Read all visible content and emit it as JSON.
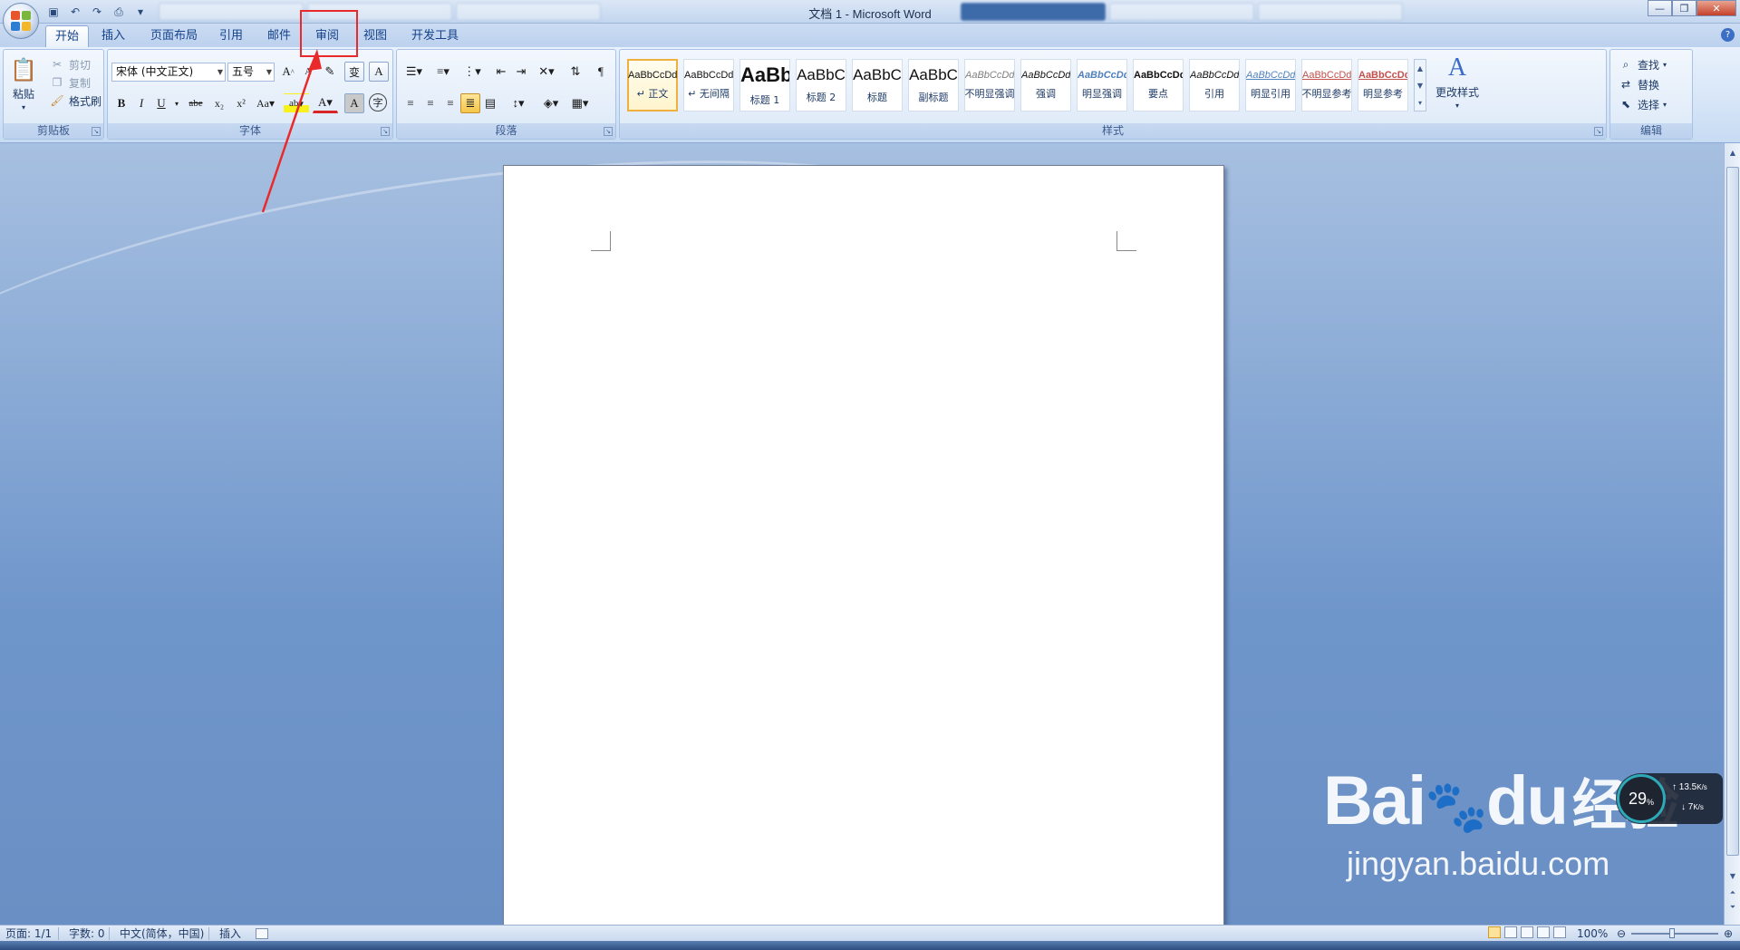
{
  "window": {
    "title": "文档 1 - Microsoft Word",
    "controls": [
      "minimize",
      "restore",
      "close"
    ]
  },
  "tabs": [
    {
      "label": "开始",
      "active": true
    },
    {
      "label": "插入"
    },
    {
      "label": "页面布局"
    },
    {
      "label": "引用"
    },
    {
      "label": "邮件"
    },
    {
      "label": "审阅",
      "highlighted": true
    },
    {
      "label": "视图"
    },
    {
      "label": "开发工具"
    }
  ],
  "clipboard": {
    "paste": "粘贴",
    "cut": "剪切",
    "copy": "复制",
    "format_painter": "格式刷",
    "group": "剪贴板"
  },
  "font": {
    "name": "宋体 (中文正文)",
    "size": "五号",
    "group": "字体",
    "buttons": {
      "grow": "A",
      "shrink": "A",
      "phonetic": "变",
      "border": "A",
      "bold": "B",
      "italic": "I",
      "underline": "U",
      "strike": "abe",
      "subscript": "x₂",
      "superscript": "x²",
      "case": "Aa",
      "highlight": "ab",
      "color": "A",
      "shading": "A",
      "enclose": "字"
    }
  },
  "paragraph": {
    "group": "段落"
  },
  "styles": {
    "group": "样式",
    "items": [
      {
        "sample": "AaBbCcDd",
        "name": "↵ 正文",
        "selected": true
      },
      {
        "sample": "AaBbCcDd",
        "name": "↵ 无间隔"
      },
      {
        "sample": "AaBb",
        "name": "标题 1"
      },
      {
        "sample": "AaBbC",
        "name": "标题 2"
      },
      {
        "sample": "AaBbC",
        "name": "标题"
      },
      {
        "sample": "AaBbC",
        "name": "副标题"
      },
      {
        "sample": "AaBbCcDd",
        "name": "不明显强调"
      },
      {
        "sample": "AaBbCcDd",
        "name": "强调"
      },
      {
        "sample": "AaBbCcDd",
        "name": "明显强调"
      },
      {
        "sample": "AaBbCcDd",
        "name": "要点"
      },
      {
        "sample": "AaBbCcDd",
        "name": "引用"
      },
      {
        "sample": "AaBbCcDd",
        "name": "明显引用"
      },
      {
        "sample": "AaBbCcDd",
        "name": "不明显参考"
      },
      {
        "sample": "AaBbCcDd",
        "name": "明显参考"
      }
    ],
    "change_styles": "更改样式"
  },
  "editing": {
    "group": "编辑",
    "find": "查找",
    "replace": "替换",
    "select": "选择"
  },
  "status": {
    "page": "页面: 1/1",
    "words": "字数: 0",
    "language": "中文(简体，中国)",
    "mode": "插入",
    "zoom": "100%"
  },
  "net": {
    "percent": "29",
    "percent_sign": "%",
    "up": "13.5",
    "up_unit": "K/s",
    "down": "7",
    "down_unit": "K/s"
  },
  "watermark": {
    "brand": "Bai",
    "brand2": "du",
    "cn": "经验",
    "url": "jingyan.baidu.com"
  },
  "colors": {
    "highlight_box": "#ea2a2a",
    "ribbon": "#d6e5f7",
    "workspace": "#6f96cb"
  }
}
